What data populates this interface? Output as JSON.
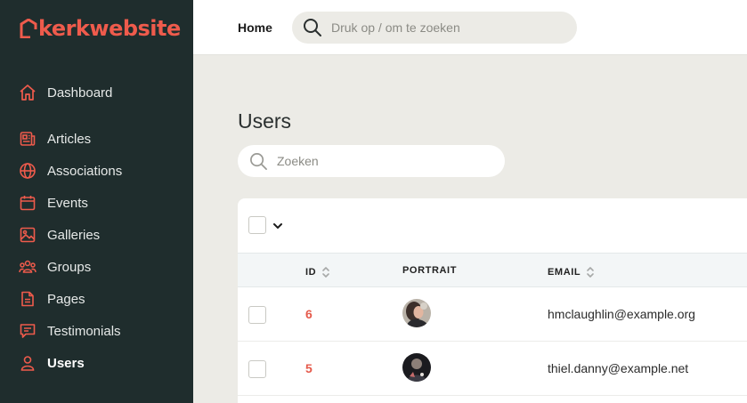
{
  "brand": {
    "name": "kerkwebsite",
    "accent": "#ef5b4c"
  },
  "sidebar": {
    "items": [
      {
        "label": "Dashboard",
        "icon": "home-icon"
      },
      {
        "label": "Articles",
        "icon": "newspaper-icon"
      },
      {
        "label": "Associations",
        "icon": "globe-icon"
      },
      {
        "label": "Events",
        "icon": "calendar-icon"
      },
      {
        "label": "Galleries",
        "icon": "image-icon"
      },
      {
        "label": "Groups",
        "icon": "users-group-icon"
      },
      {
        "label": "Pages",
        "icon": "document-icon"
      },
      {
        "label": "Testimonials",
        "icon": "message-icon"
      },
      {
        "label": "Users",
        "icon": "user-icon",
        "active": true
      }
    ]
  },
  "topbar": {
    "home_label": "Home",
    "search_placeholder": "Druk op / om te zoeken"
  },
  "main": {
    "title": "Users",
    "search_placeholder": "Zoeken",
    "table": {
      "columns": [
        {
          "label": "ID",
          "sortable": true
        },
        {
          "label": "PORTRAIT",
          "sortable": false
        },
        {
          "label": "EMAIL",
          "sortable": true
        }
      ],
      "rows": [
        {
          "id": "6",
          "email": "hmclaughlin@example.org"
        },
        {
          "id": "5",
          "email": "thiel.danny@example.net"
        }
      ]
    }
  }
}
